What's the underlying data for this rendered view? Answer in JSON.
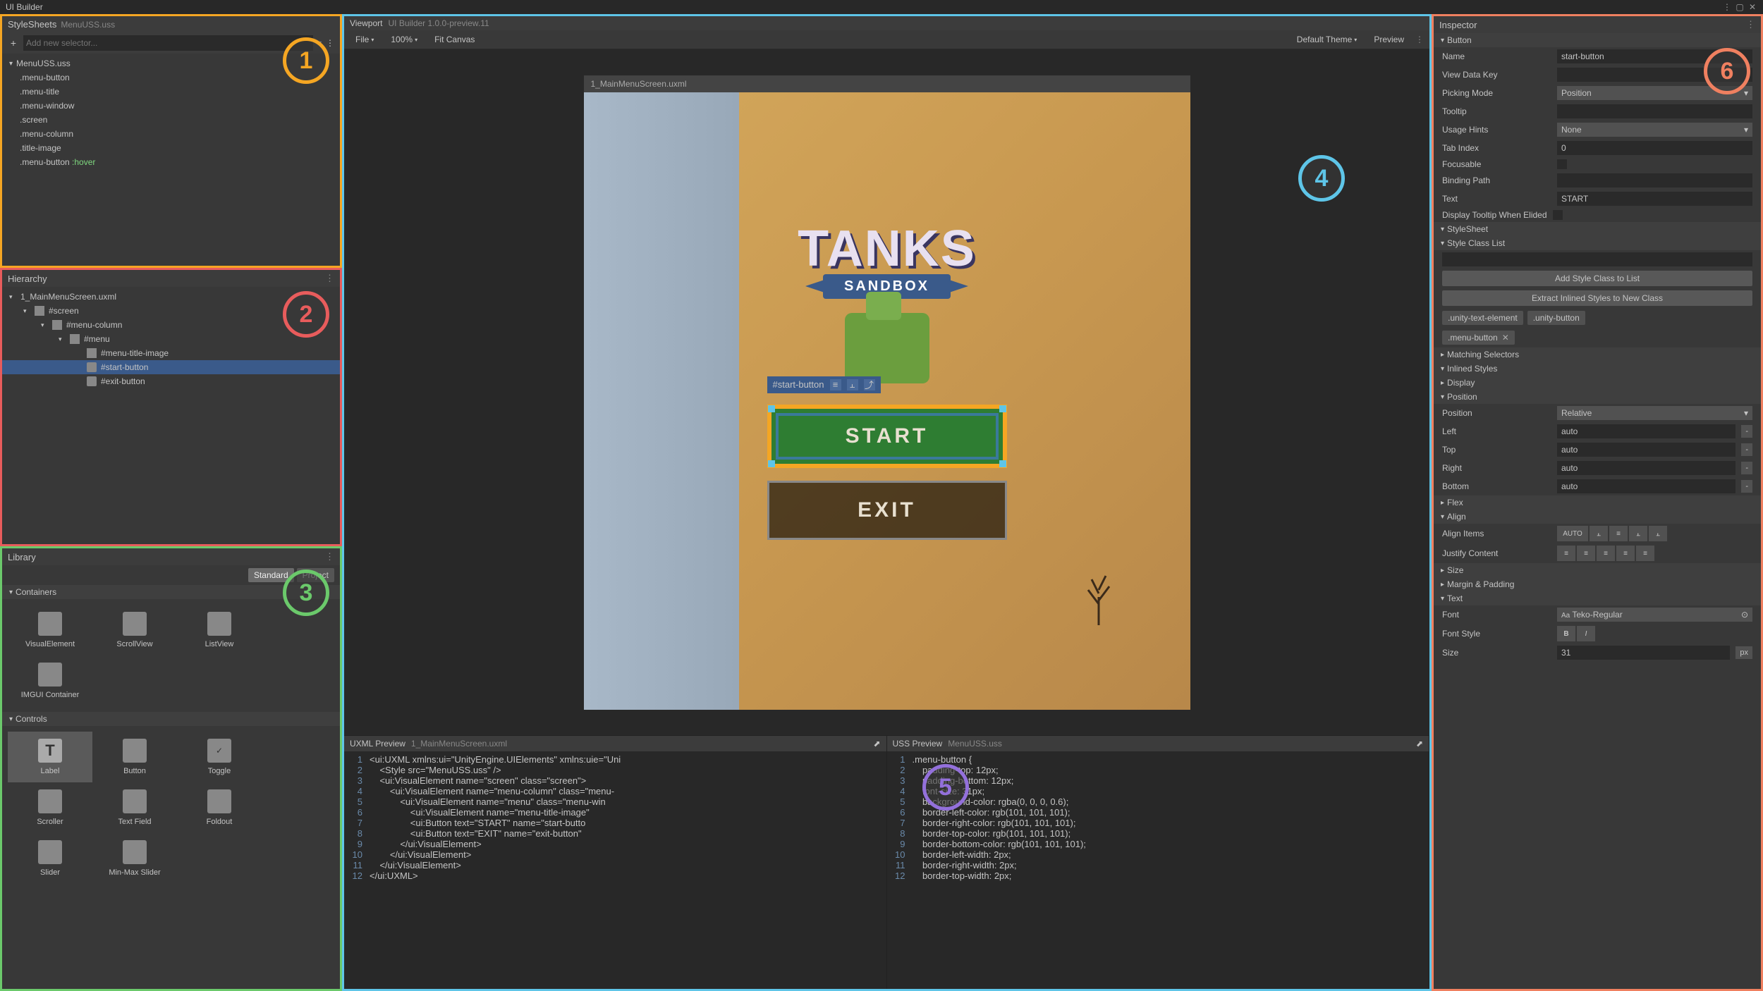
{
  "titleBar": {
    "title": "UI Builder"
  },
  "panels": {
    "stylesheets": {
      "title": "StyleSheets",
      "file": "MenuUSS.uss",
      "addSelectorPlaceholder": "Add new selector...",
      "rootFile": "MenuUSS.uss",
      "selectors": [
        ".menu-button",
        ".menu-title",
        ".menu-window",
        ".screen",
        ".menu-column",
        ".title-image",
        ".menu-button :hover"
      ]
    },
    "hierarchy": {
      "title": "Hierarchy",
      "rootFile": "1_MainMenuScreen.uxml",
      "items": [
        {
          "name": "#screen",
          "indent": 1,
          "type": "ve"
        },
        {
          "name": "#menu-column",
          "indent": 2,
          "type": "ve"
        },
        {
          "name": "#menu",
          "indent": 3,
          "type": "ve"
        },
        {
          "name": "#menu-title-image",
          "indent": 4,
          "type": "ve"
        },
        {
          "name": "#start-button",
          "indent": 4,
          "type": "btn",
          "selected": true
        },
        {
          "name": "#exit-button",
          "indent": 4,
          "type": "btn"
        }
      ]
    },
    "library": {
      "title": "Library",
      "tabs": [
        "Standard",
        "Project"
      ],
      "activeTab": "Standard",
      "sections": {
        "containers": {
          "title": "Containers",
          "items": [
            "VisualElement",
            "ScrollView",
            "ListView",
            "IMGUI Container"
          ]
        },
        "controls": {
          "title": "Controls",
          "items": [
            "Label",
            "Button",
            "Toggle",
            "Scroller",
            "Text Field",
            "Foldout",
            "Slider",
            "Min-Max Slider"
          ]
        }
      }
    }
  },
  "viewport": {
    "title": "Viewport",
    "subtitle": "UI Builder 1.0.0-preview.11",
    "toolbar": {
      "file": "File",
      "zoom": "100%",
      "fitCanvas": "Fit Canvas",
      "theme": "Default Theme",
      "preview": "Preview"
    },
    "canvasTitle": "1_MainMenuScreen.uxml",
    "selectionLabel": "#start-button",
    "game": {
      "title": "TANKS",
      "subtitle": "SANDBOX",
      "startBtn": "START",
      "exitBtn": "EXIT"
    }
  },
  "uxmlPreview": {
    "title": "UXML Preview",
    "file": "1_MainMenuScreen.uxml",
    "lines": [
      "<ui:UXML xmlns:ui=\"UnityEngine.UIElements\" xmlns:uie=\"Uni",
      "    <Style src=\"MenuUSS.uss\" />",
      "    <ui:VisualElement name=\"screen\" class=\"screen\">",
      "        <ui:VisualElement name=\"menu-column\" class=\"menu-",
      "            <ui:VisualElement name=\"menu\" class=\"menu-win",
      "                <ui:VisualElement name=\"menu-title-image\"",
      "                <ui:Button text=\"START\" name=\"start-butto",
      "                <ui:Button text=\"EXIT\" name=\"exit-button\"",
      "            </ui:VisualElement>",
      "        </ui:VisualElement>",
      "    </ui:VisualElement>",
      "</ui:UXML>"
    ]
  },
  "ussPreview": {
    "title": "USS Preview",
    "file": "MenuUSS.uss",
    "lines": [
      ".menu-button {",
      "    padding-top: 12px;",
      "    padding-bottom: 12px;",
      "    font-size: 31px;",
      "    background-color: rgba(0, 0, 0, 0.6);",
      "    border-left-color: rgb(101, 101, 101);",
      "    border-right-color: rgb(101, 101, 101);",
      "    border-top-color: rgb(101, 101, 101);",
      "    border-bottom-color: rgb(101, 101, 101);",
      "    border-left-width: 2px;",
      "    border-right-width: 2px;",
      "    border-top-width: 2px;"
    ]
  },
  "inspector": {
    "title": "Inspector",
    "elementType": "Button",
    "fields": {
      "name": {
        "label": "Name",
        "value": "start-button"
      },
      "viewDataKey": {
        "label": "View Data Key",
        "value": ""
      },
      "pickingMode": {
        "label": "Picking Mode",
        "value": "Position"
      },
      "tooltip": {
        "label": "Tooltip",
        "value": ""
      },
      "usageHints": {
        "label": "Usage Hints",
        "value": "None"
      },
      "tabIndex": {
        "label": "Tab Index",
        "value": "0"
      },
      "focusable": {
        "label": "Focusable"
      },
      "bindingPath": {
        "label": "Binding Path",
        "value": ""
      },
      "text": {
        "label": "Text",
        "value": "START"
      },
      "displayTooltip": {
        "label": "Display Tooltip When Elided"
      }
    },
    "sections": {
      "stylesheet": "StyleSheet",
      "styleClassList": "Style Class List",
      "matchingSelectors": "Matching Selectors",
      "inlinedStyles": "Inlined Styles",
      "display": "Display",
      "position": "Position",
      "flex": "Flex",
      "align": "Align",
      "size": "Size",
      "marginPadding": "Margin & Padding",
      "textSec": "Text"
    },
    "buttons": {
      "addStyleClass": "Add Style Class to List",
      "extractStyles": "Extract Inlined Styles to New Class"
    },
    "styleChips": [
      ".unity-text-element",
      ".unity-button",
      ".menu-button"
    ],
    "position": {
      "positionLabel": "Position",
      "positionVal": "Relative",
      "left": {
        "label": "Left",
        "value": "auto"
      },
      "top": {
        "label": "Top",
        "value": "auto"
      },
      "right": {
        "label": "Right",
        "value": "auto"
      },
      "bottom": {
        "label": "Bottom",
        "value": "auto"
      }
    },
    "align": {
      "alignItems": "Align Items",
      "justifyContent": "Justify Content",
      "autoLabel": "AUTO"
    },
    "text": {
      "fontLabel": "Font",
      "fontValue": "Teko-Regular",
      "fontStyleLabel": "Font Style",
      "sizeLabel": "Size",
      "sizeValue": "31",
      "sizeUnit": "px"
    }
  },
  "callouts": {
    "n1": "1",
    "n2": "2",
    "n3": "3",
    "n4": "4",
    "n5": "5",
    "n6": "6"
  }
}
